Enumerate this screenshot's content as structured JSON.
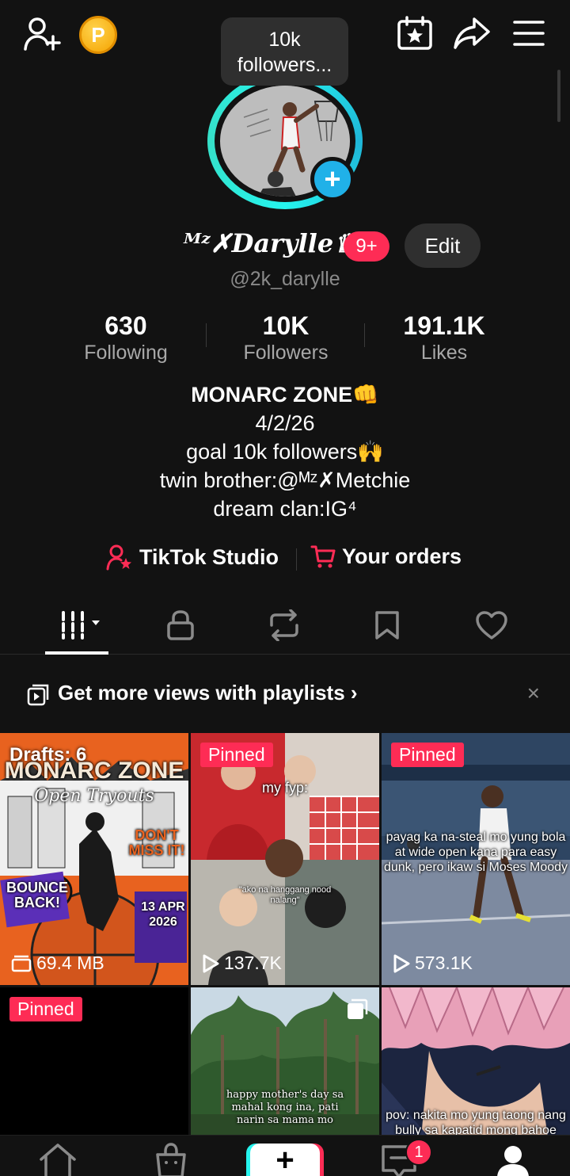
{
  "header": {
    "coin_label": "P",
    "tooltip": "10k followers..."
  },
  "profile": {
    "name": "ᴹᶻ✗Darylle♛",
    "notification_count": "9+",
    "edit_label": "Edit",
    "handle": "@2k_darylle"
  },
  "stats": [
    {
      "value": "630",
      "label": "Following"
    },
    {
      "value": "10K",
      "label": "Followers"
    },
    {
      "value": "191.1K",
      "label": "Likes"
    }
  ],
  "bio": {
    "line1": "MONARC ZONE👊",
    "line2": "4/2/26",
    "line3": "goal 10k followers🙌",
    "line4": "twin brother:@ᴹᶻ✗Metchie",
    "line5": "dream clan:IG⁴"
  },
  "links": {
    "studio": "TikTok Studio",
    "orders": "Your orders"
  },
  "playlist_banner": {
    "text": "Get more views with playlists",
    "chevron": "›",
    "close": "×"
  },
  "videos": [
    {
      "badge": "Drafts: 6",
      "stat": "69.4 MB",
      "caption_top": "MONARC ZONE",
      "caption_mid": "Open Tryouts",
      "caption_side": "DON'T MISS IT!",
      "caption_bottom": "BOUNCE BACK!",
      "date": "13 APR 2026"
    },
    {
      "badge": "Pinned",
      "stat": "137.7K",
      "caption_top": "my fyp:",
      "caption_mid": "\"ako na hanggang nood nalang\""
    },
    {
      "badge": "Pinned",
      "stat": "573.1K",
      "caption": "payag ka na-steal mo yung bola at wide open kana para easy dunk, pero ikaw si Moses Moody"
    },
    {
      "badge": "Pinned"
    },
    {
      "caption": "happy mother's day sa mahal kong ina, pati narin sa mama mo"
    },
    {
      "caption": "pov: nakita mo yung taong nang bully sa kapatid mong bahoe"
    }
  ],
  "bottom_nav": {
    "create": "+",
    "inbox_count": "1"
  },
  "colors": {
    "background": "#121212",
    "accent_red": "#fe2c55",
    "accent_cyan": "#25f4ee",
    "plus_blue": "#20b1e8"
  }
}
